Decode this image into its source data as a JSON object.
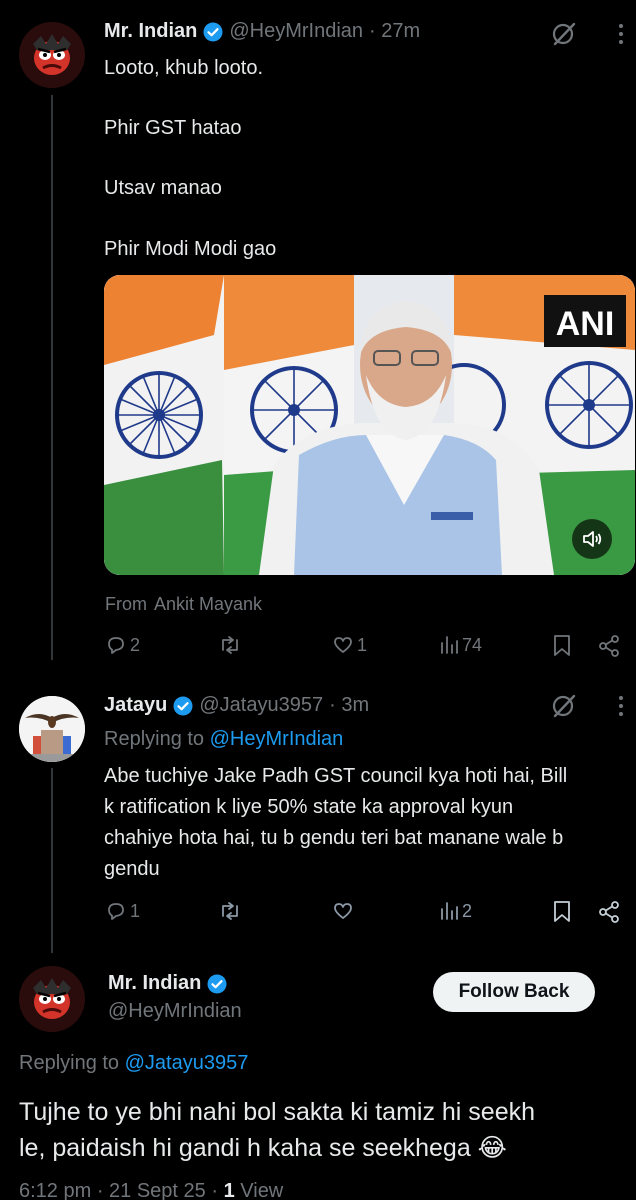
{
  "tweet1": {
    "name": "Mr. Indian",
    "handle": "@HeyMrIndian",
    "dot_time": "· 27m",
    "lines": [
      "Looto, khub looto.",
      "Phir GST hatao",
      "Utsav manao",
      "Phir Modi Modi gao"
    ],
    "media_watermark": "ANI",
    "from_label": "From",
    "from_name": "Ankit Mayank",
    "actions": {
      "replies": "2",
      "likes": "1",
      "views": "74"
    }
  },
  "tweet2": {
    "name": "Jatayu",
    "handle": "@Jatayu3957",
    "dot_time": "· 3m",
    "replying_label": "Replying to",
    "replying_to": "@HeyMrIndian",
    "lines": [
      "Abe tuchiye Jake Padh GST council kya hoti hai, Bill",
      "k ratification k liye 50% state ka approval kyun",
      "chahiye hota hai, tu b gendu teri bat manane wale b",
      "gendu"
    ],
    "actions": {
      "replies": "1",
      "views": "2"
    }
  },
  "tweet3": {
    "name": "Mr. Indian",
    "handle": "@HeyMrIndian",
    "follow_label": "Follow Back",
    "replying_label": "Replying to",
    "replying_to": "@Jatayu3957",
    "lines": [
      "Tujhe to ye bhi nahi bol sakta ki tamiz hi seekh",
      "le, paidaish hi gandi h kaha se seekhega 😂"
    ],
    "meta_time": "6:12 pm · 21 Sept 25 ·",
    "meta_views": "1",
    "meta_views_label": "View"
  },
  "icons": [
    "verified-badge-icon",
    "grok-icon",
    "more-icon",
    "reply-icon",
    "retweet-icon",
    "like-icon",
    "views-icon",
    "bookmark-icon",
    "share-icon",
    "mute-icon"
  ],
  "colors": {
    "background": "#000000",
    "text": "#e7e9ea",
    "muted": "#71767b",
    "accent": "#1d9bf0",
    "thread_line": "#333639"
  }
}
